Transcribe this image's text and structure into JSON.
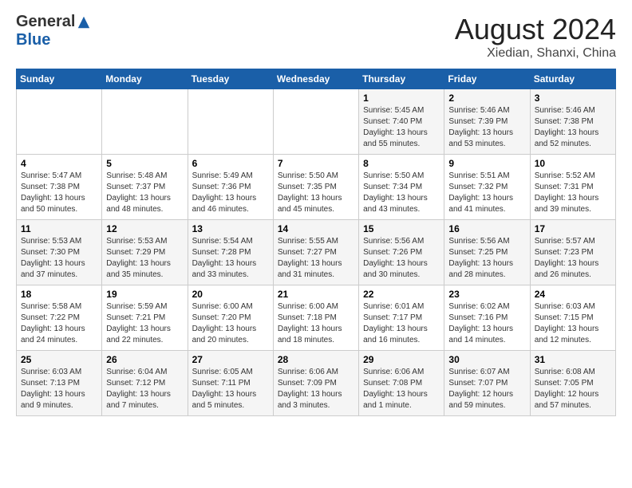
{
  "logo": {
    "general": "General",
    "blue": "Blue"
  },
  "header": {
    "month_title": "August 2024",
    "location": "Xiedian, Shanxi, China"
  },
  "weekdays": [
    "Sunday",
    "Monday",
    "Tuesday",
    "Wednesday",
    "Thursday",
    "Friday",
    "Saturday"
  ],
  "weeks": [
    [
      {
        "day": "",
        "info": ""
      },
      {
        "day": "",
        "info": ""
      },
      {
        "day": "",
        "info": ""
      },
      {
        "day": "",
        "info": ""
      },
      {
        "day": "1",
        "info": "Sunrise: 5:45 AM\nSunset: 7:40 PM\nDaylight: 13 hours\nand 55 minutes."
      },
      {
        "day": "2",
        "info": "Sunrise: 5:46 AM\nSunset: 7:39 PM\nDaylight: 13 hours\nand 53 minutes."
      },
      {
        "day": "3",
        "info": "Sunrise: 5:46 AM\nSunset: 7:38 PM\nDaylight: 13 hours\nand 52 minutes."
      }
    ],
    [
      {
        "day": "4",
        "info": "Sunrise: 5:47 AM\nSunset: 7:38 PM\nDaylight: 13 hours\nand 50 minutes."
      },
      {
        "day": "5",
        "info": "Sunrise: 5:48 AM\nSunset: 7:37 PM\nDaylight: 13 hours\nand 48 minutes."
      },
      {
        "day": "6",
        "info": "Sunrise: 5:49 AM\nSunset: 7:36 PM\nDaylight: 13 hours\nand 46 minutes."
      },
      {
        "day": "7",
        "info": "Sunrise: 5:50 AM\nSunset: 7:35 PM\nDaylight: 13 hours\nand 45 minutes."
      },
      {
        "day": "8",
        "info": "Sunrise: 5:50 AM\nSunset: 7:34 PM\nDaylight: 13 hours\nand 43 minutes."
      },
      {
        "day": "9",
        "info": "Sunrise: 5:51 AM\nSunset: 7:32 PM\nDaylight: 13 hours\nand 41 minutes."
      },
      {
        "day": "10",
        "info": "Sunrise: 5:52 AM\nSunset: 7:31 PM\nDaylight: 13 hours\nand 39 minutes."
      }
    ],
    [
      {
        "day": "11",
        "info": "Sunrise: 5:53 AM\nSunset: 7:30 PM\nDaylight: 13 hours\nand 37 minutes."
      },
      {
        "day": "12",
        "info": "Sunrise: 5:53 AM\nSunset: 7:29 PM\nDaylight: 13 hours\nand 35 minutes."
      },
      {
        "day": "13",
        "info": "Sunrise: 5:54 AM\nSunset: 7:28 PM\nDaylight: 13 hours\nand 33 minutes."
      },
      {
        "day": "14",
        "info": "Sunrise: 5:55 AM\nSunset: 7:27 PM\nDaylight: 13 hours\nand 31 minutes."
      },
      {
        "day": "15",
        "info": "Sunrise: 5:56 AM\nSunset: 7:26 PM\nDaylight: 13 hours\nand 30 minutes."
      },
      {
        "day": "16",
        "info": "Sunrise: 5:56 AM\nSunset: 7:25 PM\nDaylight: 13 hours\nand 28 minutes."
      },
      {
        "day": "17",
        "info": "Sunrise: 5:57 AM\nSunset: 7:23 PM\nDaylight: 13 hours\nand 26 minutes."
      }
    ],
    [
      {
        "day": "18",
        "info": "Sunrise: 5:58 AM\nSunset: 7:22 PM\nDaylight: 13 hours\nand 24 minutes."
      },
      {
        "day": "19",
        "info": "Sunrise: 5:59 AM\nSunset: 7:21 PM\nDaylight: 13 hours\nand 22 minutes."
      },
      {
        "day": "20",
        "info": "Sunrise: 6:00 AM\nSunset: 7:20 PM\nDaylight: 13 hours\nand 20 minutes."
      },
      {
        "day": "21",
        "info": "Sunrise: 6:00 AM\nSunset: 7:18 PM\nDaylight: 13 hours\nand 18 minutes."
      },
      {
        "day": "22",
        "info": "Sunrise: 6:01 AM\nSunset: 7:17 PM\nDaylight: 13 hours\nand 16 minutes."
      },
      {
        "day": "23",
        "info": "Sunrise: 6:02 AM\nSunset: 7:16 PM\nDaylight: 13 hours\nand 14 minutes."
      },
      {
        "day": "24",
        "info": "Sunrise: 6:03 AM\nSunset: 7:15 PM\nDaylight: 13 hours\nand 12 minutes."
      }
    ],
    [
      {
        "day": "25",
        "info": "Sunrise: 6:03 AM\nSunset: 7:13 PM\nDaylight: 13 hours\nand 9 minutes."
      },
      {
        "day": "26",
        "info": "Sunrise: 6:04 AM\nSunset: 7:12 PM\nDaylight: 13 hours\nand 7 minutes."
      },
      {
        "day": "27",
        "info": "Sunrise: 6:05 AM\nSunset: 7:11 PM\nDaylight: 13 hours\nand 5 minutes."
      },
      {
        "day": "28",
        "info": "Sunrise: 6:06 AM\nSunset: 7:09 PM\nDaylight: 13 hours\nand 3 minutes."
      },
      {
        "day": "29",
        "info": "Sunrise: 6:06 AM\nSunset: 7:08 PM\nDaylight: 13 hours\nand 1 minute."
      },
      {
        "day": "30",
        "info": "Sunrise: 6:07 AM\nSunset: 7:07 PM\nDaylight: 12 hours\nand 59 minutes."
      },
      {
        "day": "31",
        "info": "Sunrise: 6:08 AM\nSunset: 7:05 PM\nDaylight: 12 hours\nand 57 minutes."
      }
    ]
  ]
}
